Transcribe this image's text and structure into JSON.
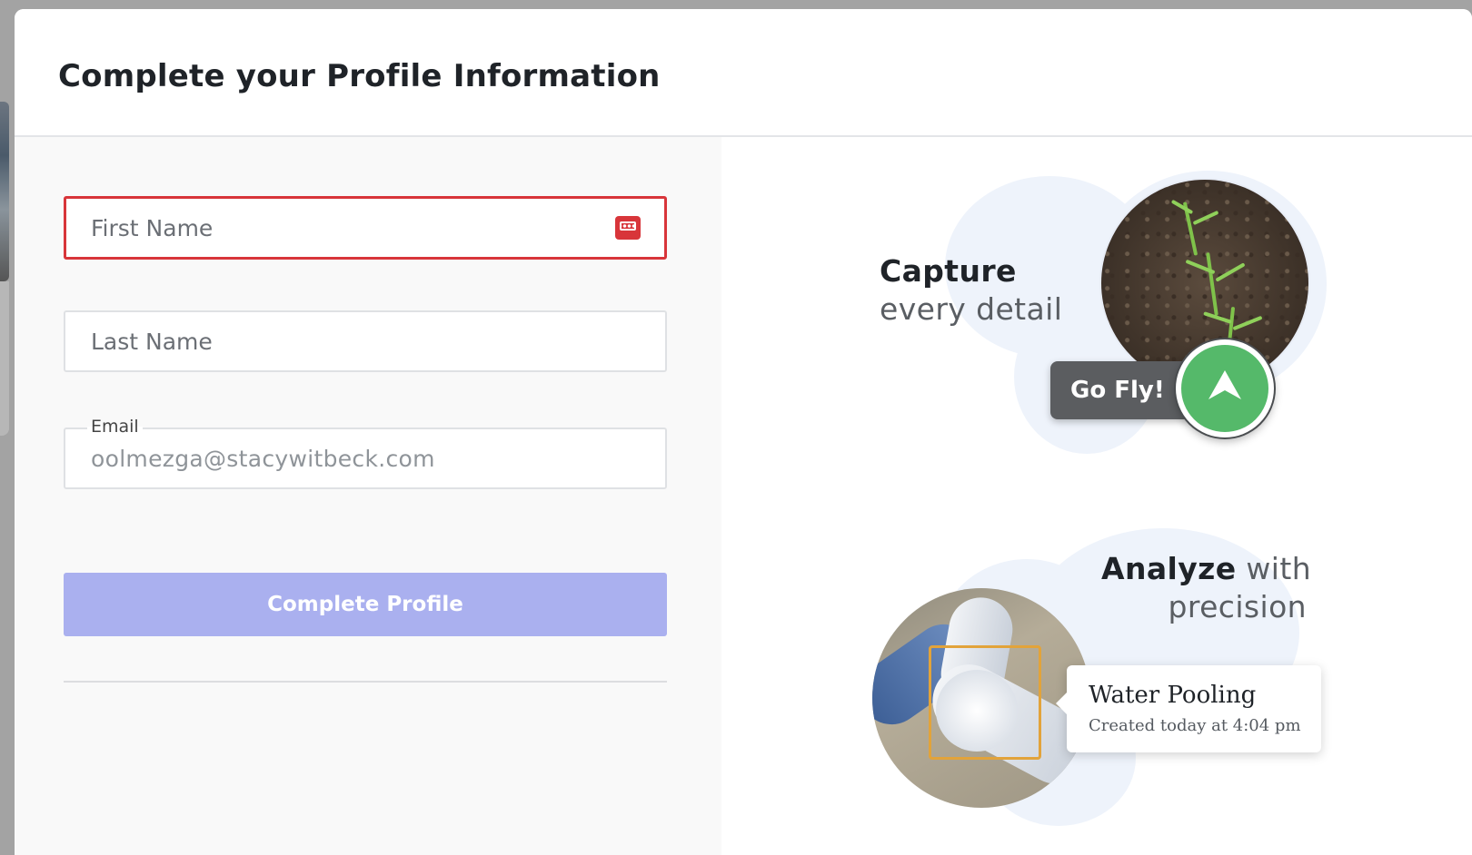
{
  "dialog": {
    "title": "Complete your Profile Information"
  },
  "form": {
    "first_name": {
      "placeholder": "First Name",
      "value": ""
    },
    "last_name": {
      "placeholder": "Last Name",
      "value": ""
    },
    "email": {
      "label": "Email",
      "value": "oolmezga@stacywitbeck.com"
    },
    "submit_label": "Complete Profile"
  },
  "promo": {
    "capture": {
      "bold": "Capture",
      "rest": "every detail"
    },
    "go_fly_label": "Go Fly!",
    "analyze": {
      "bold": "Analyze",
      "rest_line1": " with",
      "rest_line2": "precision"
    },
    "card": {
      "title": "Water Pooling",
      "subtitle": "Created today at 4:04 pm"
    }
  },
  "colors": {
    "error_border": "#d8353a",
    "button_disabled": "#aab0ef",
    "go_fly_green": "#55b96a",
    "detect_box": "#e2a33a"
  },
  "icons": {
    "password_manager": "password-manager-icon",
    "go_fly": "arrow-up-icon"
  }
}
